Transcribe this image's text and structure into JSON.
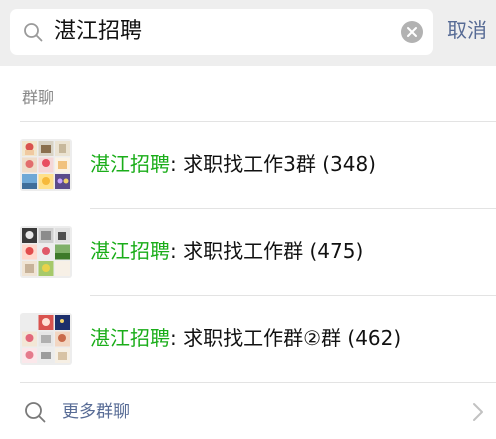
{
  "search": {
    "query": "湛江招聘",
    "clear_icon": "clear-circle-icon",
    "search_icon": "search-icon",
    "cancel_label": "取消"
  },
  "section": {
    "title": "群聊"
  },
  "results": [
    {
      "highlight": "湛江招聘",
      "separator": ":",
      "name": "求职找工作3群 (348)"
    },
    {
      "highlight": "湛江招聘",
      "separator": ":",
      "name": "求职找工作群 (475)"
    },
    {
      "highlight": "湛江招聘",
      "separator": ":",
      "name": "求职找工作群②群 (462)"
    }
  ],
  "more": {
    "label": "更多群聊",
    "icon": "search-icon",
    "chevron": "chevron-right-icon"
  },
  "colors": {
    "highlight": "#1aad19",
    "link": "#576b95",
    "background": "#eeeeee"
  }
}
